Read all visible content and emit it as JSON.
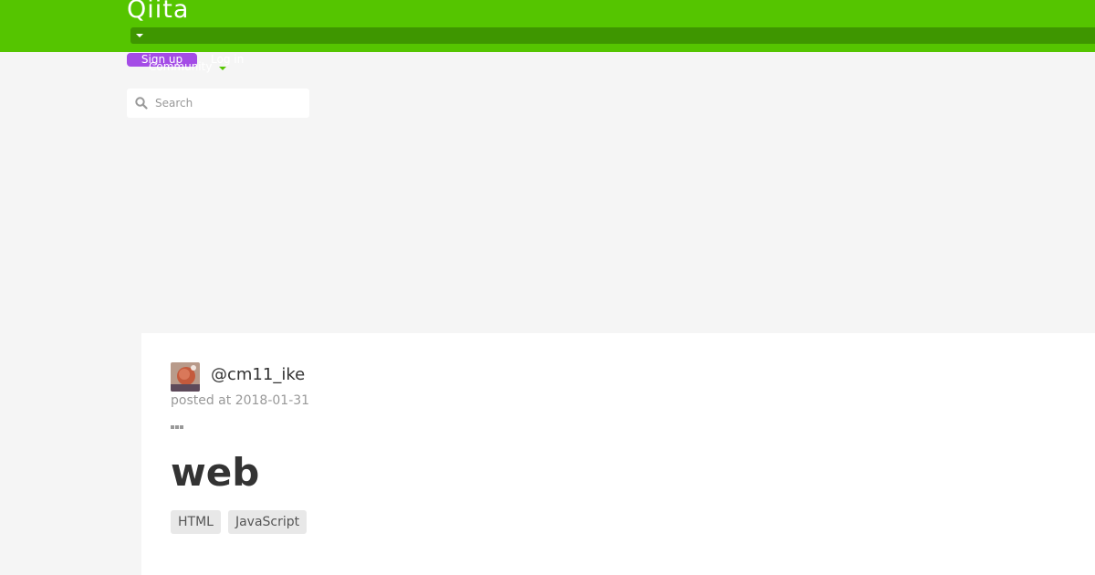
{
  "header": {
    "logo": "Qiita",
    "signup_label": "Sign up",
    "login_label": "Log in",
    "community_label": "Community"
  },
  "search": {
    "placeholder": "Search"
  },
  "article": {
    "username": "@cm11_ike",
    "posted": "posted at 2018-01-31",
    "title": "web",
    "tags": [
      "HTML",
      "JavaScript"
    ]
  },
  "colors": {
    "brand": "#55c500",
    "signup": "#a44ce6"
  },
  "icons": [
    "search-icon",
    "chevron-down-icon",
    "more-icon",
    "avatar"
  ]
}
